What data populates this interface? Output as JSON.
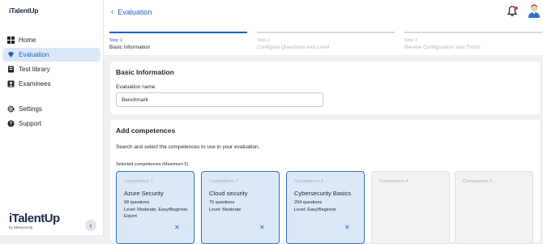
{
  "sidebar": {
    "logo": "iTalentUp",
    "items": [
      {
        "label": "Home",
        "icon": "grid-icon"
      },
      {
        "label": "Evaluation",
        "icon": "diamond-icon",
        "active": true
      },
      {
        "label": "Test library",
        "icon": "book-icon"
      },
      {
        "label": "Examinees",
        "icon": "person-card-icon"
      },
      {
        "label": "Settings",
        "icon": "gear-icon"
      },
      {
        "label": "Support",
        "icon": "help-icon"
      }
    ],
    "brand": "iTalentUp",
    "brand_sub": "by MeasureUp"
  },
  "header": {
    "back_label": "Evaluation",
    "accent": "#1c63c7",
    "notification_color": "#e63b3b"
  },
  "steps": [
    {
      "num": "Step 1",
      "name": "Basic Information"
    },
    {
      "num": "Step 2",
      "name": "Configure Questions and Level"
    },
    {
      "num": "Step 3",
      "name": "Review Configuration and Finish"
    }
  ],
  "basic": {
    "title": "Basic Information",
    "name_label": "Evaluation name",
    "name_value": "Benchmark"
  },
  "competences": {
    "title": "Add competences",
    "description": "Search and select the competences to use in your evaluation.",
    "selected_label": "Selected competences (Maximum 5)",
    "slots": [
      {
        "label": "Competence 1",
        "title": "Azure Security",
        "questions": "68 questions",
        "level": "Level:  Moderate, Easy/Beginner, Expert"
      },
      {
        "label": "Competence 2",
        "title": "Cloud security",
        "questions": "76 questions",
        "level": "Level:  Moderate"
      },
      {
        "label": "Competence 3",
        "title": "Cybersecurity Basics",
        "questions": "204 questions",
        "level": "Level:  Easy/Beginner"
      },
      {
        "label": "Competence 4"
      },
      {
        "label": "Competence 5"
      }
    ]
  }
}
